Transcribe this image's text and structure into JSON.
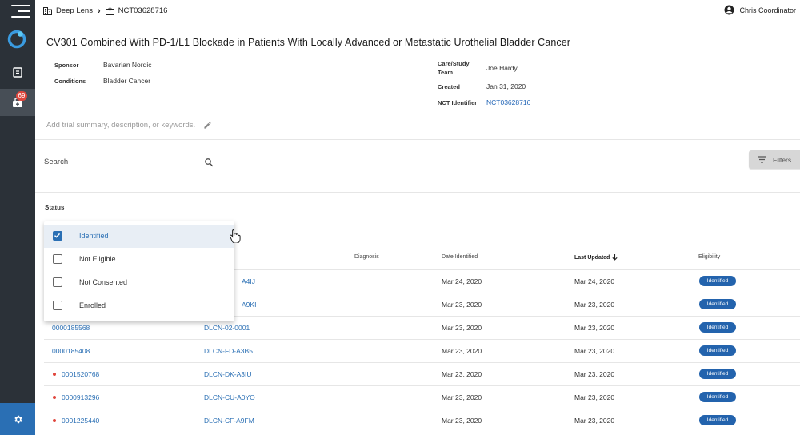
{
  "breadcrumb": {
    "org": "Deep Lens",
    "trial": "NCT03628716"
  },
  "user": {
    "name": "Chris Coordinator"
  },
  "nav": {
    "badge_count": "69"
  },
  "trial": {
    "title": "CV301 Combined With PD-1/L1 Blockade in Patients With Locally Advanced or Metastatic Urothelial Bladder Cancer",
    "sponsor_label": "Sponsor",
    "sponsor": "Bavarian Nordic",
    "conditions_label": "Conditions",
    "conditions": "Bladder Cancer",
    "team_label_1": "Care/Study",
    "team_label_2": "Team",
    "team": "Joe Hardy",
    "created_label": "Created",
    "created": "Jan 31, 2020",
    "nct_label": "NCT Identifier",
    "nct": "NCT03628716",
    "summary_placeholder": "Add trial summary, description, or keywords."
  },
  "search": {
    "placeholder": "Search"
  },
  "filters_label": "Filters",
  "status_label": "Status",
  "status_options": [
    {
      "label": "Identified",
      "checked": true
    },
    {
      "label": "Not Eligible",
      "checked": false
    },
    {
      "label": "Not Consented",
      "checked": false
    },
    {
      "label": "Enrolled",
      "checked": false
    }
  ],
  "table": {
    "headers": {
      "diagnosis": "Diagnosis",
      "date_identified": "Date Identified",
      "last_updated": "Last Updated",
      "eligibility": "Eligibility"
    },
    "rows": [
      {
        "mrn": "",
        "patient_id": "A4IJ",
        "date_identified": "Mar 24, 2020",
        "last_updated": "Mar 24, 2020",
        "eligibility": "Identified"
      },
      {
        "mrn": "",
        "patient_id": "A9KI",
        "date_identified": "Mar 23, 2020",
        "last_updated": "Mar 23, 2020",
        "eligibility": "Identified"
      },
      {
        "mrn": "0000185568",
        "patient_id": "DLCN-02-0001",
        "date_identified": "Mar 23, 2020",
        "last_updated": "Mar 23, 2020",
        "eligibility": "Identified"
      },
      {
        "mrn": "0000185408",
        "patient_id": "DLCN-FD-A3B5",
        "date_identified": "Mar 23, 2020",
        "last_updated": "Mar 23, 2020",
        "eligibility": "Identified"
      },
      {
        "mrn": "0001520768",
        "patient_id": "DLCN-DK-A3IU",
        "date_identified": "Mar 23, 2020",
        "last_updated": "Mar 23, 2020",
        "eligibility": "Identified",
        "flag": true
      },
      {
        "mrn": "0000913296",
        "patient_id": "DLCN-CU-A0YO",
        "date_identified": "Mar 23, 2020",
        "last_updated": "Mar 23, 2020",
        "eligibility": "Identified",
        "flag": true
      },
      {
        "mrn": "0001225440",
        "patient_id": "DLCN-CF-A9FM",
        "date_identified": "Mar 23, 2020",
        "last_updated": "Mar 23, 2020",
        "eligibility": "Identified",
        "flag": true
      }
    ]
  },
  "colors": {
    "rail": "#2b3138",
    "accent": "#2a6fb4",
    "pill": "#2363ad",
    "alert": "#e0463c"
  },
  "icons": [
    "menu-icon",
    "logo-icon",
    "document-icon",
    "patients-icon",
    "settings-icon",
    "building-icon",
    "chevron-right-icon",
    "hospital-icon",
    "account-icon",
    "pencil-icon",
    "search-icon",
    "filter-icon",
    "arrow-down-icon",
    "checkmark-icon",
    "hand-cursor-icon"
  ]
}
